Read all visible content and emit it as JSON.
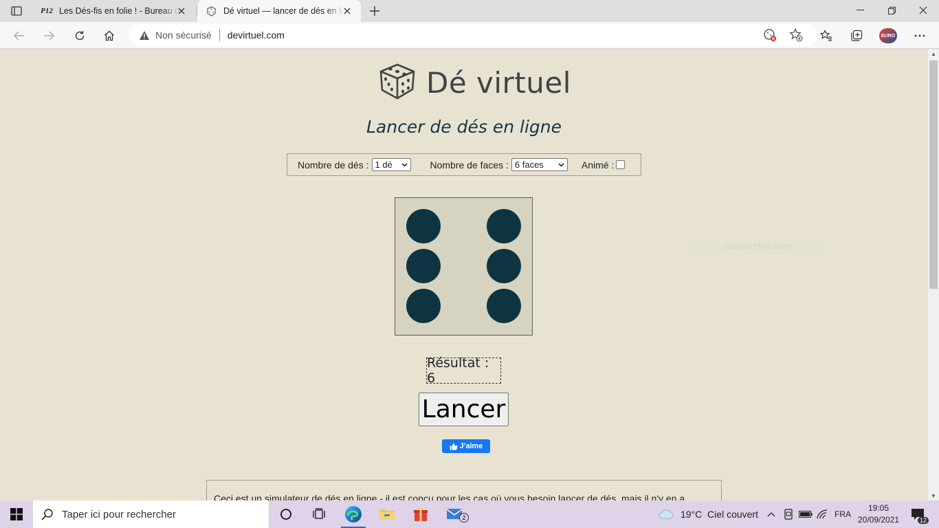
{
  "browser": {
    "tabs": [
      {
        "favicon_text": "P12",
        "title": "Les Dés-fis en folie ! - Bureau de"
      },
      {
        "title": "Dé virtuel — lancer de dés en lig"
      }
    ],
    "address": {
      "security_label": "Non sécurisé",
      "url": "devirtuel.com"
    }
  },
  "page": {
    "site_title": "Dé virtuel",
    "subtitle": "Lancer de dés en ligne",
    "options": {
      "dice_count_label": "Nombre de dés :",
      "dice_count_value": "1 dé",
      "faces_label": "Nombre de faces :",
      "faces_value": "6 faces",
      "animated_label": "Animé :",
      "animated_checked": false
    },
    "die_value": 6,
    "result_text": "Résultat : 6",
    "roll_button": "Lancer",
    "like_button": "J'aime",
    "ghost_overlay": "Capture Plein écran",
    "description": "Ceci est un simulateur de dés en ligne - il est conçu pour les cas où vous besoin lancer de dés, mais il n'y en a"
  },
  "taskbar": {
    "search_placeholder": "Taper ici pour rechercher",
    "mail_badge": "2",
    "weather": "19°C  Ciel couvert",
    "language": "FRA",
    "time": "19:05",
    "date": "20/09/2021",
    "notifications_count": "12"
  },
  "colors": {
    "page_bg": "#e8e3d1",
    "pip": "#0e3442",
    "die_face": "#d6d3c1",
    "fb_blue": "#1877f2",
    "taskbar_bg": "#ded3e8"
  }
}
